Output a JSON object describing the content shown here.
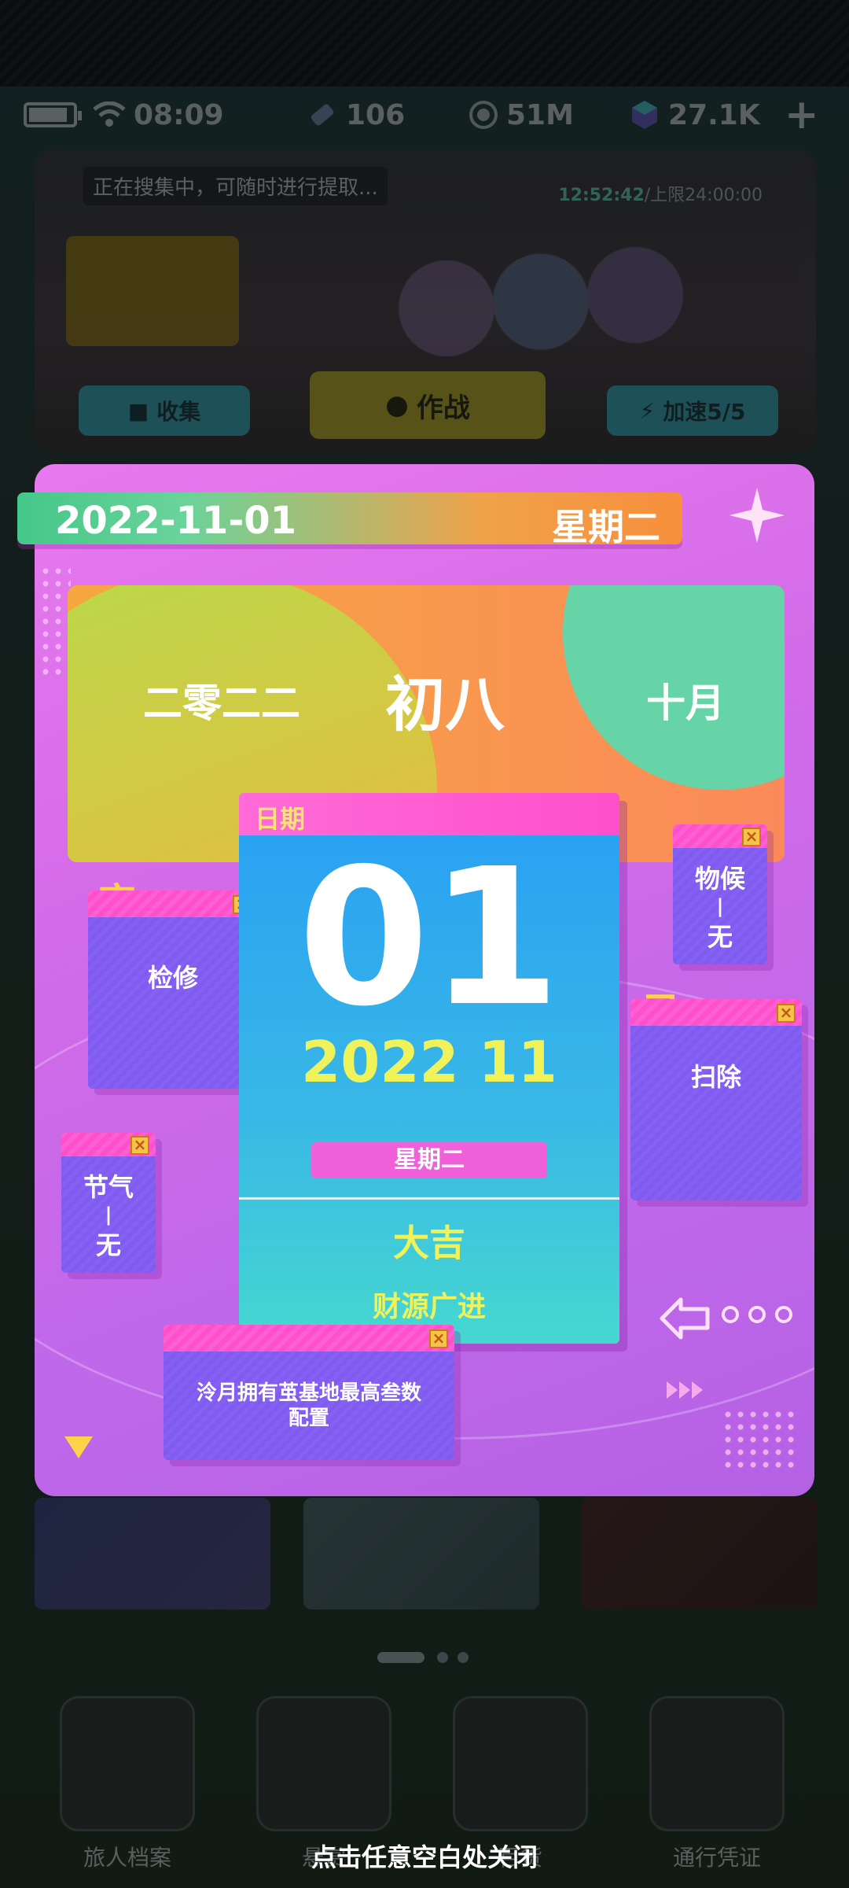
{
  "status_bar": {
    "time": "08:09",
    "currency_1": "106",
    "currency_2": "51M",
    "currency_3": "27.1K",
    "add_symbol": "+"
  },
  "collector": {
    "message": "正在搜集中，可随时进行提取...",
    "timer_value": "12:52:42",
    "timer_limit": "/上限24:00:00",
    "collect_label": "收集",
    "battle_label": "作战",
    "boost_label": "加速5/5"
  },
  "calendar": {
    "date": "2022-11-01",
    "weekday": "星期二",
    "lunar_year": "二零二二",
    "lunar_day": "初八",
    "lunar_month": "十月",
    "date_window_title": "日期",
    "day": "01",
    "year_month": "2022 11",
    "weekday_badge": "星期二",
    "fortune": "大吉",
    "fortune_detail": "财源广进",
    "suitable_char": "宜",
    "suitable_text": "检修",
    "avoid_char": "忌",
    "avoid_text": "扫除",
    "phenology_label": "物候",
    "phenology_value": "无",
    "solar_term_label": "节气",
    "solar_term_value": "无",
    "note": "泠月拥有茧基地最高叁数配置"
  },
  "dock": {
    "items": [
      "旅人档案",
      "悬赏",
      "百货",
      "通行凭证"
    ]
  },
  "close_hint": "点击任意空白处关闭",
  "colors": {
    "card": "#d46be8",
    "window_bar": "#ff4fcb",
    "window_body": "#8560f2",
    "highlight_yellow": "#f0f25a"
  }
}
